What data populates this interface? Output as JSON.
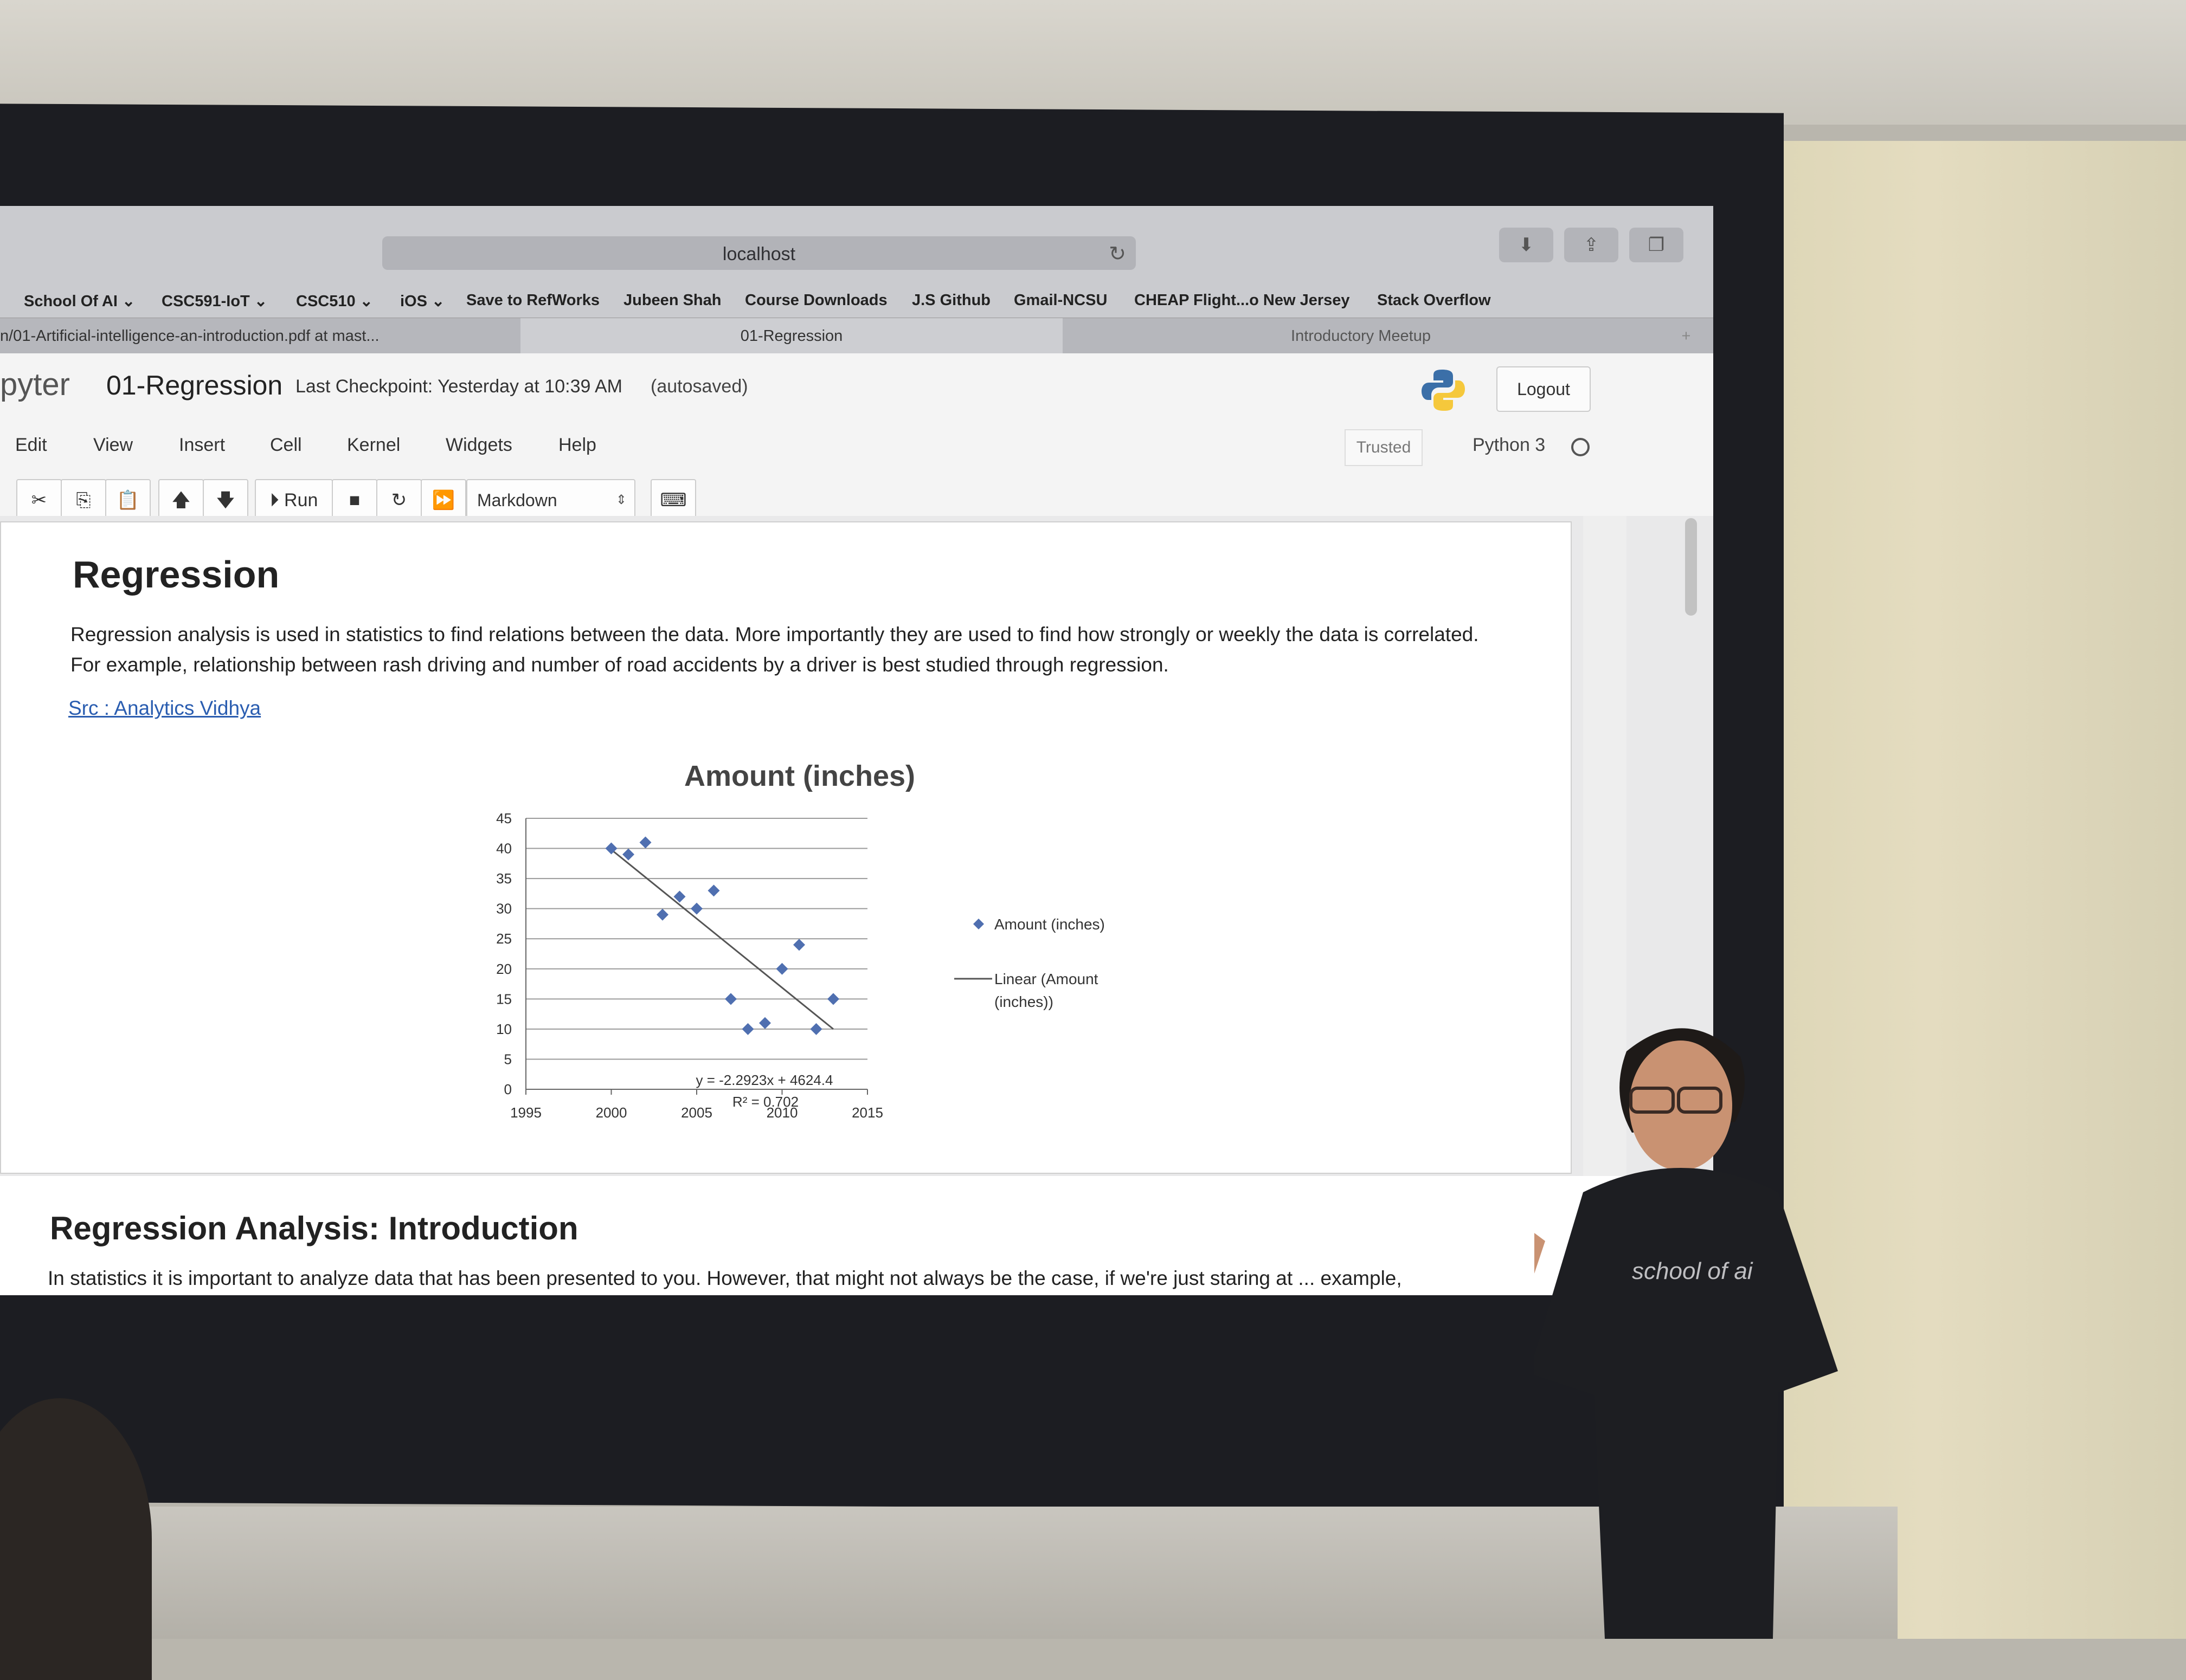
{
  "browser": {
    "url": "localhost",
    "bookmarks": [
      "School Of AI ⌄",
      "CSC591-IoT ⌄",
      "CSC510 ⌄",
      "iOS ⌄",
      "Save to RefWorks",
      "Jubeen Shah",
      "Course Downloads",
      "J.S Github",
      "Gmail-NCSU",
      "CHEAP Flight...o New Jersey",
      "Stack Overflow"
    ],
    "tabs": [
      "n/01-Artificial-intelligence-an-introduction.pdf at mast...",
      "01-Regression",
      "Introductory Meetup"
    ],
    "new_tab": "+"
  },
  "jupyter": {
    "logo_text": "pyter",
    "notebook_name": "01-Regression",
    "checkpoint": "Last Checkpoint: Yesterday at 10:39 AM",
    "autosave": "(autosaved)",
    "logout": "Logout",
    "menu": [
      "Edit",
      "View",
      "Insert",
      "Cell",
      "Kernel",
      "Widgets",
      "Help"
    ],
    "trusted": "Trusted",
    "kernel": "Python 3",
    "run_label": "Run",
    "cell_type": "Markdown"
  },
  "cell": {
    "heading": "Regression",
    "para_line1": "Regression analysis is used in statistics to find relations between the data. More importantly they are used to find how strongly or weekly the data is correlated.",
    "para_line2": "For example, relationship between rash driving and number of road accidents by a driver is best studied through regression.",
    "link": "Src : Analytics Vidhya"
  },
  "chart_data": {
    "type": "scatter",
    "title": "Amount (inches)",
    "xlim": [
      1995,
      2015
    ],
    "ylim": [
      0,
      45
    ],
    "xticks": [
      1995,
      2000,
      2005,
      2010,
      2015
    ],
    "yticks": [
      0,
      5,
      10,
      15,
      20,
      25,
      30,
      35,
      40,
      45
    ],
    "series": [
      {
        "name": "Amount (inches)",
        "color": "#4f6fb0",
        "x": [
          2000,
          2001,
          2002,
          2003,
          2004,
          2005,
          2006,
          2007,
          2008,
          2009,
          2010,
          2011,
          2012,
          2013
        ],
        "y": [
          40,
          39,
          41,
          29,
          32,
          30,
          33,
          15,
          10,
          11,
          20,
          24,
          10,
          15
        ]
      }
    ],
    "trendline": {
      "name": "Linear (Amount (inches))",
      "slope": -2.2923,
      "intercept": 4624.4,
      "x_range": [
        2000,
        2013
      ],
      "color": "#555555"
    },
    "equation": "y = -2.2923x + 4624.4",
    "r_squared": "R² = 0.702",
    "legend_position": "right",
    "grid": true
  },
  "cell2": {
    "heading": "Regression Analysis: Introduction",
    "para": "In statistics it is important to analyze data that has been presented to you. However, that might not always be the case, if we're just staring at ... example,"
  },
  "presenter_shirt": "school of ai"
}
